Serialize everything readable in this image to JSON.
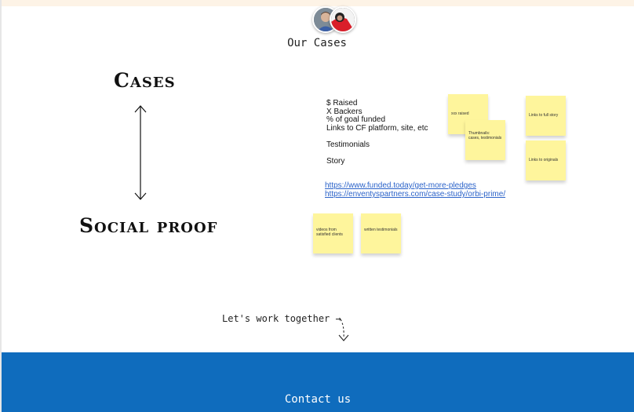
{
  "header": {
    "title": "Our Cases"
  },
  "board": {
    "cases_label": "Cases",
    "social_label": "Social proof",
    "metrics": [
      "$ Raised",
      "X Backers",
      "% of goal funded",
      "Links to CF platform, site, etc",
      "",
      "Testimonials",
      "",
      "Story"
    ],
    "links": [
      "https://www.funded.today/get-more-pledges",
      "https://enventyspartners.com/case-study/orbi-prime/"
    ],
    "stickies": {
      "xxx_raised": "xxx raised",
      "thumbnails": "Thumbnails: cases, testimonials",
      "full_story": "Links to full story",
      "originals": "Links to originals",
      "videos": "videos from satisfied clients",
      "written": "written testimonials"
    },
    "sticky_color": "#fef59c"
  },
  "cta": {
    "text": "Let's work together →"
  },
  "footer": {
    "title": "Contact us",
    "color": "#0f6cbd"
  },
  "colors": {
    "link": "#2a62c9",
    "top_band": "#fdf3e6"
  }
}
